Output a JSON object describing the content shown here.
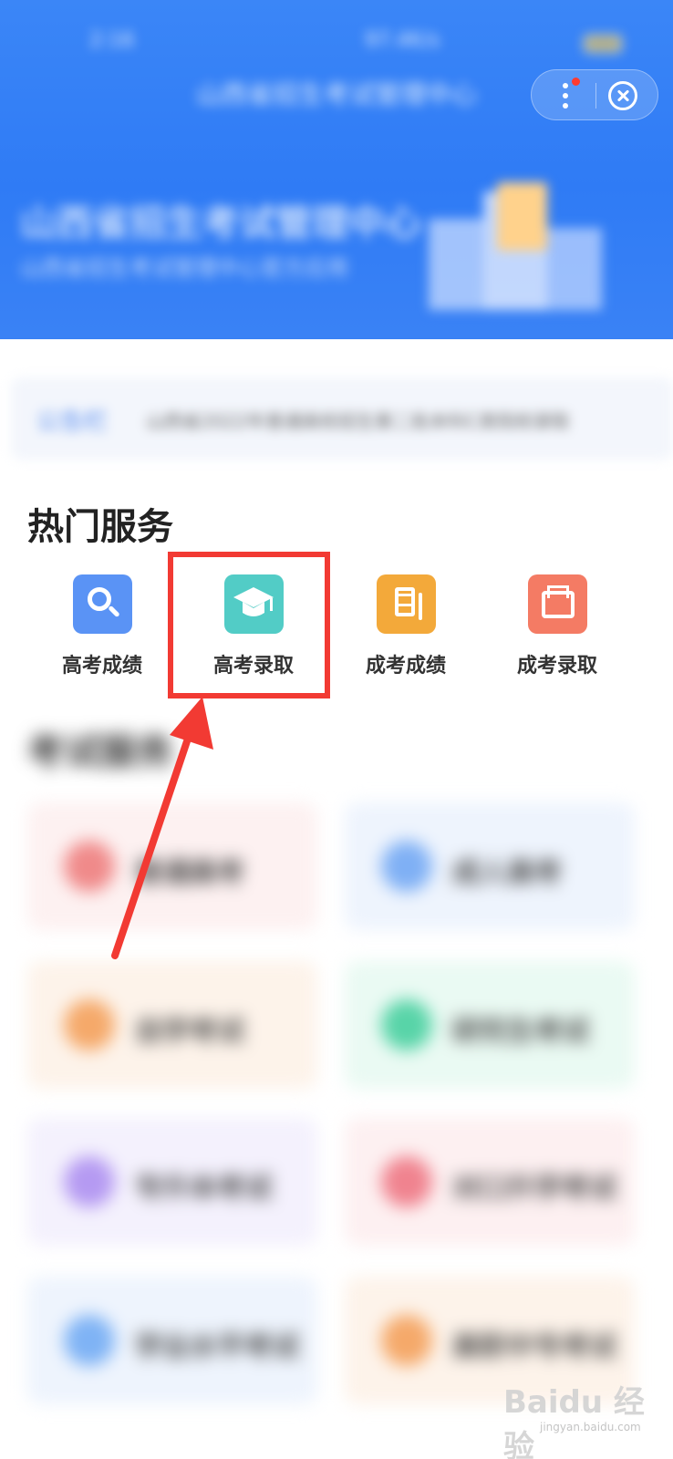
{
  "status_bar": {
    "time": "2:16",
    "network_speed": "97.4K/s"
  },
  "nav": {
    "title": "山西省招生考试管理中心"
  },
  "banner": {
    "title": "山西省招生考试管理中心",
    "subtitle": "山西省招生考试管理中心官方应用"
  },
  "notice": {
    "tag": "公告栏",
    "text": "山西省2022年普通高校招生第二批本科C类院校录取"
  },
  "hot_services": {
    "title": "热门服务",
    "items": [
      {
        "label": "高考成绩",
        "icon": "search-icon",
        "color": "#5a93f5"
      },
      {
        "label": "高考录取",
        "icon": "graduation-cap-icon",
        "color": "#52ccc6"
      },
      {
        "label": "成考成绩",
        "icon": "document-icon",
        "color": "#f3a93a"
      },
      {
        "label": "成考录取",
        "icon": "archive-icon",
        "color": "#f47b64"
      }
    ]
  },
  "exam_services": {
    "title": "考试服务",
    "items": [
      {
        "label": "普通高考",
        "color": "#f08a8a"
      },
      {
        "label": "成人高考",
        "color": "#7fb0f5"
      },
      {
        "label": "自学考试",
        "color": "#f5a96a"
      },
      {
        "label": "研究生考试",
        "color": "#58d4a8"
      },
      {
        "label": "专升本考试",
        "color": "#b59af2"
      },
      {
        "label": "对口升学考试",
        "color": "#f0838f"
      },
      {
        "label": "学业水平考试",
        "color": "#7fb3f5"
      },
      {
        "label": "高职中专考试",
        "color": "#f5a96a"
      }
    ]
  },
  "watermark": {
    "logo": "Baidu 经验",
    "url": "jingyan.baidu.com"
  }
}
